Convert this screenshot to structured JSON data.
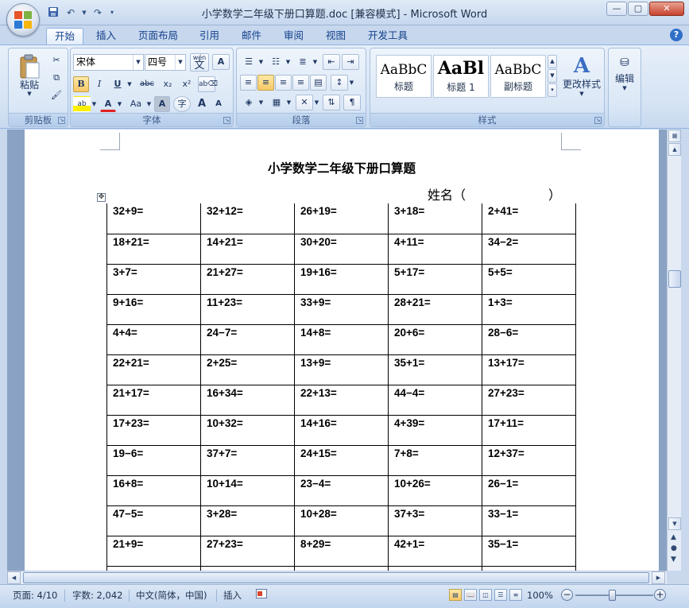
{
  "window": {
    "title": "小学数学二年级下册口算题.doc [兼容模式] - Microsoft Word",
    "controls": {
      "minimize": "—",
      "maximize": "▢",
      "close": "✕"
    }
  },
  "quick_access": {
    "save_icon": "save-icon",
    "undo_icon": "undo-icon",
    "redo_icon": "redo-icon"
  },
  "tabs": [
    "开始",
    "插入",
    "页面布局",
    "引用",
    "邮件",
    "审阅",
    "视图",
    "开发工具"
  ],
  "active_tab": "开始",
  "help": "?",
  "ribbon": {
    "clipboard": {
      "label": "剪贴板",
      "paste": "粘贴"
    },
    "font": {
      "label": "字体",
      "font_name": "宋体",
      "font_size": "四号",
      "wen": "wén",
      "wen_char": "文",
      "A": "A",
      "bold": "B",
      "italic": "I",
      "underline": "U",
      "strike": "abc",
      "subscript": "x₂",
      "superscript": "x²",
      "case": "Aa",
      "grow": "A",
      "shrink": "A",
      "char_shading": "A",
      "enclose": "字"
    },
    "paragraph": {
      "label": "段落"
    },
    "styles": {
      "label": "样式",
      "items": [
        {
          "preview": "AaBbC",
          "name": "标题"
        },
        {
          "preview": "AaBl",
          "name": "标题 1"
        },
        {
          "preview": "AaBbC",
          "name": "副标题"
        }
      ],
      "change_styles": "更改样式"
    },
    "editing": {
      "label": "编辑"
    }
  },
  "document": {
    "title": "小学数学二年级下册口算题",
    "name_label": "姓名（",
    "name_close": "）",
    "rows": [
      [
        "32+9=",
        "32+12=",
        "26+19=",
        "3+18=",
        "2+41="
      ],
      [
        "18+21=",
        "14+21=",
        "30+20=",
        "4+11=",
        "34−2="
      ],
      [
        "3+7=",
        "21+27=",
        "19+16=",
        "5+17=",
        "5+5="
      ],
      [
        "9+16=",
        "11+23=",
        "33+9=",
        "28+21=",
        "1+3="
      ],
      [
        "4+4=",
        "24−7=",
        "14+8=",
        "20+6=",
        "28−6="
      ],
      [
        "22+21=",
        "2+25=",
        "13+9=",
        "35+1=",
        "13+17="
      ],
      [
        "21+17=",
        "16+34=",
        "22+13=",
        "44−4=",
        "27+23="
      ],
      [
        "17+23=",
        "10+32=",
        "14+16=",
        "4+39=",
        "17+11="
      ],
      [
        "19−6=",
        "37+7=",
        "24+15=",
        "7+8=",
        "12+37="
      ],
      [
        "16+8=",
        "10+14=",
        "23−4=",
        "10+26=",
        "26−1="
      ],
      [
        "47−5=",
        "3+28=",
        "10+28=",
        "37+3=",
        "33−1="
      ],
      [
        "21+9=",
        "27+23=",
        "8+29=",
        "42+1=",
        "35−1="
      ],
      [
        "",
        "",
        "",
        "",
        ""
      ]
    ]
  },
  "status": {
    "page": "页面: 4/10",
    "words": "字数: 2,042",
    "language": "中文(简体，中国)",
    "mode": "插入",
    "zoom": "100%",
    "zoom_minus": "−",
    "zoom_plus": "+"
  }
}
